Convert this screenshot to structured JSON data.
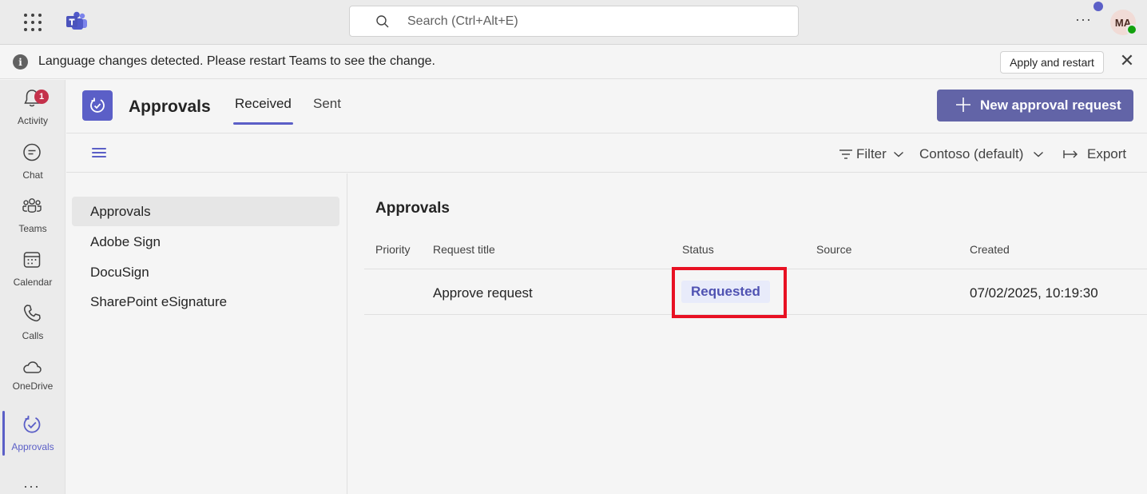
{
  "titlebar": {
    "search_placeholder": "Search (Ctrl+Alt+E)",
    "avatar_initials": "MA",
    "more_label": "···"
  },
  "banner": {
    "message": "Language changes detected. Please restart Teams to see the change.",
    "apply_label": "Apply and restart",
    "close_glyph": "✕",
    "info_glyph": "i"
  },
  "rail": {
    "items": [
      {
        "label": "Activity",
        "icon": "bell-icon",
        "badge": "1"
      },
      {
        "label": "Chat",
        "icon": "chat-icon"
      },
      {
        "label": "Teams",
        "icon": "teams-icon"
      },
      {
        "label": "Calendar",
        "icon": "calendar-icon"
      },
      {
        "label": "Calls",
        "icon": "phone-icon"
      },
      {
        "label": "OneDrive",
        "icon": "cloud-icon"
      },
      {
        "label": "Approvals",
        "icon": "approvals-icon",
        "active": true
      }
    ],
    "more_label": "···"
  },
  "app": {
    "title": "Approvals",
    "tabs": [
      {
        "label": "Received",
        "active": true
      },
      {
        "label": "Sent"
      }
    ],
    "new_button_label": "New approval request"
  },
  "toolbar": {
    "filter_label": "Filter",
    "tenant_label": "Contoso (default)",
    "export_label": "Export"
  },
  "leftnav": {
    "items": [
      {
        "label": "Approvals",
        "selected": true
      },
      {
        "label": "Adobe Sign"
      },
      {
        "label": "DocuSign"
      },
      {
        "label": "SharePoint eSignature"
      }
    ]
  },
  "main": {
    "title": "Approvals",
    "columns": [
      "Priority",
      "Request title",
      "Status",
      "Source",
      "Created"
    ],
    "rows": [
      {
        "priority": "",
        "title": "Approve request",
        "status": "Requested",
        "source": "",
        "created": "07/02/2025, 10:19:30"
      }
    ]
  },
  "colors": {
    "accent": "#5b5fc7",
    "button": "#6264a7",
    "badge": "#c4314b",
    "highlight": "#e81123",
    "status_bg": "#e8ebfa"
  }
}
